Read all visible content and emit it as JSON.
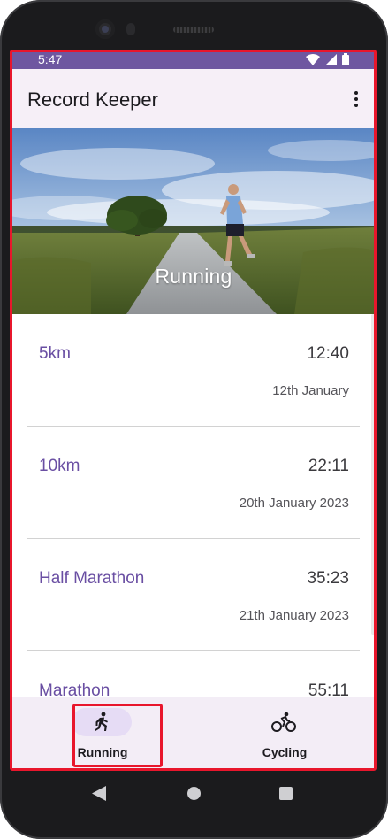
{
  "status_bar": {
    "time": "5:47",
    "icons": [
      "wifi-icon",
      "signal-icon",
      "battery-icon"
    ]
  },
  "app_bar": {
    "title": "Record Keeper",
    "menu_icon": "overflow-menu-icon"
  },
  "hero": {
    "caption": "Running",
    "image": "runner-on-country-road"
  },
  "records": [
    {
      "name": "5km",
      "time": "12:40",
      "date": "12th January"
    },
    {
      "name": "10km",
      "time": "22:11",
      "date": "20th January 2023"
    },
    {
      "name": "Half Marathon",
      "time": "35:23",
      "date": "21th January 2023"
    },
    {
      "name": "Marathon",
      "time": "55:11",
      "date": ""
    }
  ],
  "bottom_nav": {
    "items": [
      {
        "label": "Running",
        "icon": "running-icon",
        "selected": true
      },
      {
        "label": "Cycling",
        "icon": "cycling-icon",
        "selected": false
      }
    ]
  },
  "colors": {
    "primary": "#6e57a0",
    "record_name": "#6a4fa3",
    "app_bar_bg": "#f6eff7",
    "nav_bg": "#f3edf6",
    "nav_indicator": "#e6dcf5",
    "highlight": "#e8162c"
  }
}
